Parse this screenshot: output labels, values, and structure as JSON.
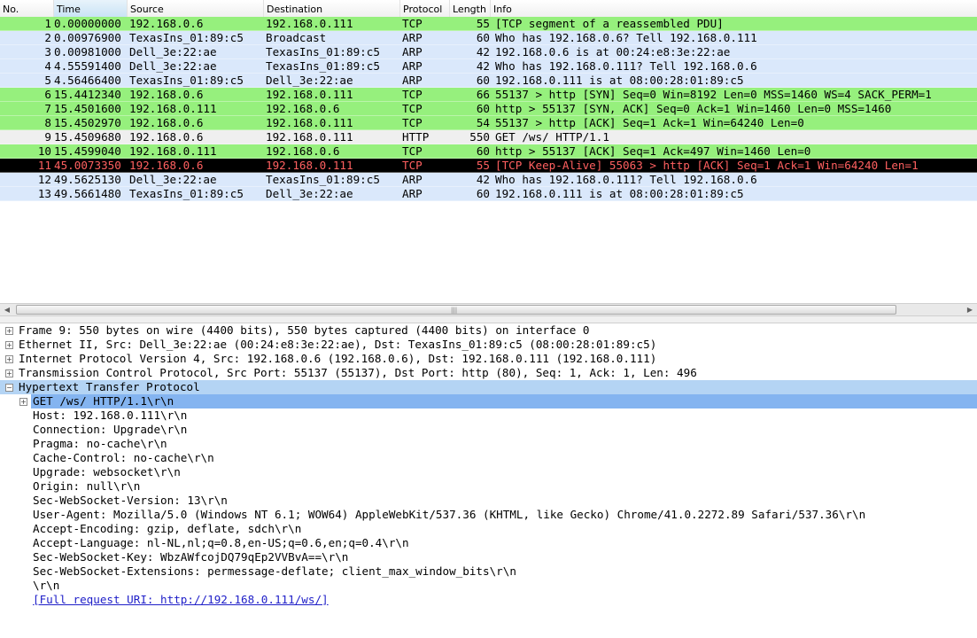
{
  "columns": {
    "no": "No.",
    "time": "Time",
    "source": "Source",
    "destination": "Destination",
    "protocol": "Protocol",
    "length": "Length",
    "info": "Info"
  },
  "packets": [
    {
      "no": "1",
      "time": "0.00000000",
      "source": "192.168.0.6",
      "destination": "192.168.0.111",
      "protocol": "TCP",
      "length": "55",
      "info": "[TCP segment of a reassembled PDU]"
    },
    {
      "no": "2",
      "time": "0.00976900",
      "source": "TexasIns_01:89:c5",
      "destination": "Broadcast",
      "protocol": "ARP",
      "length": "60",
      "info": "Who has 192.168.0.6?  Tell 192.168.0.111"
    },
    {
      "no": "3",
      "time": "0.00981000",
      "source": "Dell_3e:22:ae",
      "destination": "TexasIns_01:89:c5",
      "protocol": "ARP",
      "length": "42",
      "info": "192.168.0.6 is at 00:24:e8:3e:22:ae"
    },
    {
      "no": "4",
      "time": "4.55591400",
      "source": "Dell_3e:22:ae",
      "destination": "TexasIns_01:89:c5",
      "protocol": "ARP",
      "length": "42",
      "info": "Who has 192.168.0.111?  Tell 192.168.0.6"
    },
    {
      "no": "5",
      "time": "4.56466400",
      "source": "TexasIns_01:89:c5",
      "destination": "Dell_3e:22:ae",
      "protocol": "ARP",
      "length": "60",
      "info": "192.168.0.111 is at 08:00:28:01:89:c5"
    },
    {
      "no": "6",
      "time": "15.4412340",
      "source": "192.168.0.6",
      "destination": "192.168.0.111",
      "protocol": "TCP",
      "length": "66",
      "info": "55137 > http [SYN] Seq=0 Win=8192 Len=0 MSS=1460 WS=4 SACK_PERM=1"
    },
    {
      "no": "7",
      "time": "15.4501600",
      "source": "192.168.0.111",
      "destination": "192.168.0.6",
      "protocol": "TCP",
      "length": "60",
      "info": "http > 55137 [SYN, ACK] Seq=0 Ack=1 Win=1460 Len=0 MSS=1460"
    },
    {
      "no": "8",
      "time": "15.4502970",
      "source": "192.168.0.6",
      "destination": "192.168.0.111",
      "protocol": "TCP",
      "length": "54",
      "info": "55137 > http [ACK] Seq=1 Ack=1 Win=64240 Len=0"
    },
    {
      "no": "9",
      "time": "15.4509680",
      "source": "192.168.0.6",
      "destination": "192.168.0.111",
      "protocol": "HTTP",
      "length": "550",
      "info": "GET /ws/ HTTP/1.1"
    },
    {
      "no": "10",
      "time": "15.4599040",
      "source": "192.168.0.111",
      "destination": "192.168.0.6",
      "protocol": "TCP",
      "length": "60",
      "info": "http > 55137 [ACK] Seq=1 Ack=497 Win=1460 Len=0"
    },
    {
      "no": "11",
      "time": "45.0073350",
      "source": "192.168.0.6",
      "destination": "192.168.0.111",
      "protocol": "TCP",
      "length": "55",
      "info": "[TCP Keep-Alive] 55063 > http [ACK] Seq=1 Ack=1 Win=64240 Len=1"
    },
    {
      "no": "12",
      "time": "49.5625130",
      "source": "Dell_3e:22:ae",
      "destination": "TexasIns_01:89:c5",
      "protocol": "ARP",
      "length": "42",
      "info": "Who has 192.168.0.111?  Tell 192.168.0.6"
    },
    {
      "no": "13",
      "time": "49.5661480",
      "source": "TexasIns_01:89:c5",
      "destination": "Dell_3e:22:ae",
      "protocol": "ARP",
      "length": "60",
      "info": "192.168.0.111 is at 08:00:28:01:89:c5"
    }
  ],
  "colors": {
    "tcp": "#96f07d",
    "arp": "#dae8fb",
    "http": "#e8f8e0",
    "bad_bg": "#000000",
    "bad_fg": "#ff6060",
    "tree_highlight": "#b4d4f4",
    "tree_selected": "#84b4f0"
  },
  "scrollbar": {
    "left_arrow": "◀",
    "right_arrow": "▶",
    "grip": "|||"
  },
  "details": {
    "expand_symbol": "+",
    "collapse_symbol": "−",
    "frame": "Frame 9: 550 bytes on wire (4400 bits), 550 bytes captured (4400 bits) on interface 0",
    "ethernet": "Ethernet II, Src: Dell_3e:22:ae (00:24:e8:3e:22:ae), Dst: TexasIns_01:89:c5 (08:00:28:01:89:c5)",
    "ip": "Internet Protocol Version 4, Src: 192.168.0.6 (192.168.0.6), Dst: 192.168.0.111 (192.168.0.111)",
    "tcp": "Transmission Control Protocol, Src Port: 55137 (55137), Dst Port: http (80), Seq: 1, Ack: 1, Len: 496",
    "http": "Hypertext Transfer Protocol",
    "http_fields": [
      "GET /ws/ HTTP/1.1\\r\\n",
      "Host: 192.168.0.111\\r\\n",
      "Connection: Upgrade\\r\\n",
      "Pragma: no-cache\\r\\n",
      "Cache-Control: no-cache\\r\\n",
      "Upgrade: websocket\\r\\n",
      "Origin: null\\r\\n",
      "Sec-WebSocket-Version: 13\\r\\n",
      "User-Agent: Mozilla/5.0 (Windows NT 6.1; WOW64) AppleWebKit/537.36 (KHTML, like Gecko) Chrome/41.0.2272.89 Safari/537.36\\r\\n",
      "Accept-Encoding: gzip, deflate, sdch\\r\\n",
      "Accept-Language: nl-NL,nl;q=0.8,en-US;q=0.6,en;q=0.4\\r\\n",
      "Sec-WebSocket-Key: WbzAWfcojDQ79qEp2VVBvA==\\r\\n",
      "Sec-WebSocket-Extensions: permessage-deflate; client_max_window_bits\\r\\n",
      "\\r\\n"
    ],
    "full_uri": "[Full request URI: http://192.168.0.111/ws/]"
  }
}
